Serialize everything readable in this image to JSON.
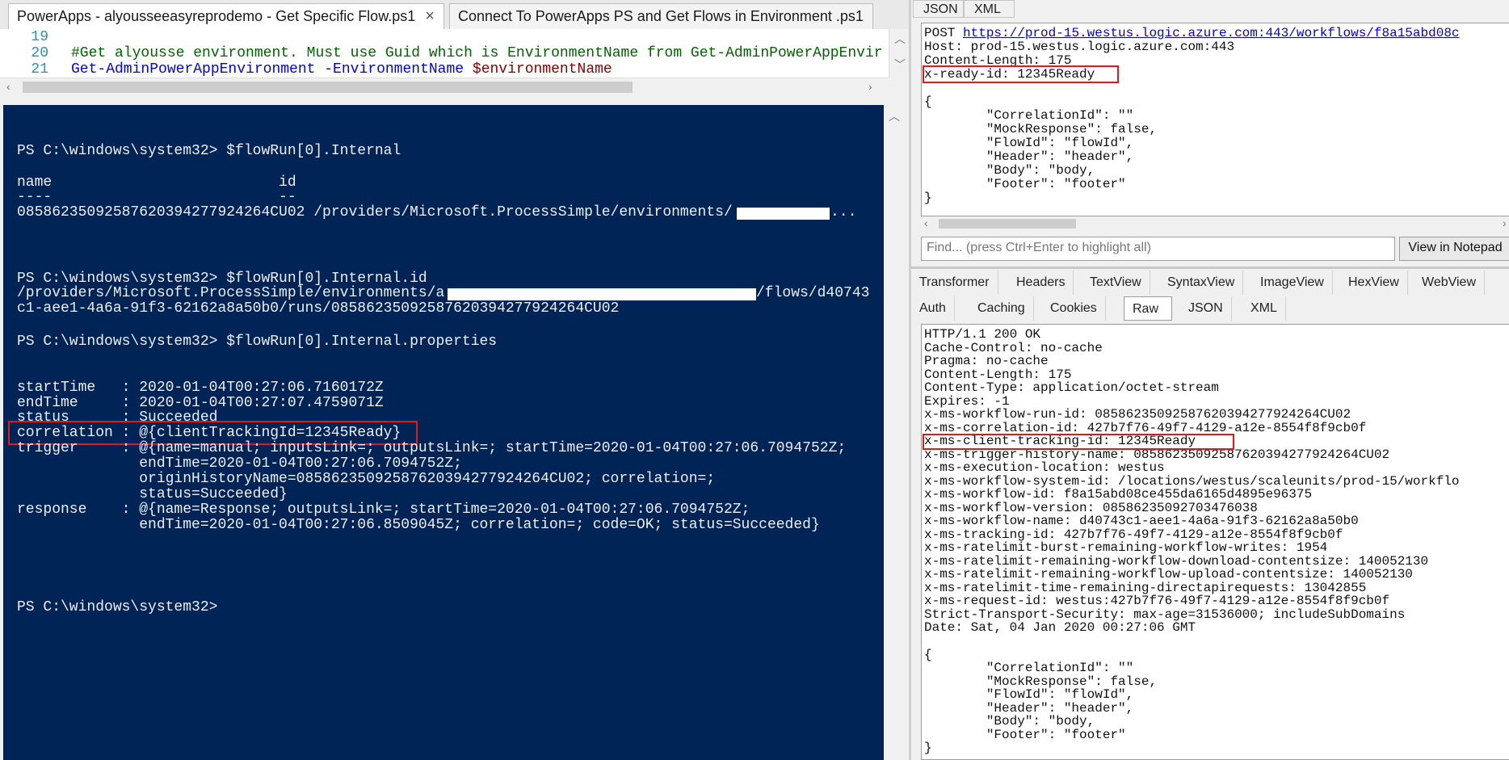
{
  "ise": {
    "tabs": [
      {
        "label": "PowerApps - alyousseeasyreprodemo - Get Specific Flow.ps1",
        "close": "×"
      },
      {
        "label": "Connect To PowerApps PS and Get Flows in Environment .ps1"
      }
    ],
    "editor": {
      "lines": [
        {
          "num": "19",
          "comment": "",
          "cmd": "",
          "arg": "",
          "var": ""
        },
        {
          "num": "20",
          "comment": "#Get alyousse environment. Must use Guid which is EnvironmentName from Get-AdminPowerAppEnvir",
          "cmd": "",
          "arg": "",
          "var": ""
        },
        {
          "num": "21",
          "comment": "",
          "cmd": "Get-AdminPowerAppEnvironment",
          "arg": " -EnvironmentName ",
          "var": "$environmentName"
        }
      ]
    },
    "console": {
      "lines": [
        "PS C:\\windows\\system32> $flowRun[0].Internal",
        "name                          id",
        "----                          --",
        "08586235092587620394277924264CU02 /providers/Microsoft.ProcessSimple/environments/",
        "...",
        "PS C:\\windows\\system32> $flowRun[0].Internal.id",
        "/providers/Microsoft.ProcessSimple/environments/a",
        "/flows/d40743",
        "c1-aee1-4a6a-91f3-62162a8a50b0/runs/08586235092587620394277924264CU02",
        "PS C:\\windows\\system32> $flowRun[0].Internal.properties",
        "startTime   : 2020-01-04T00:27:06.7160172Z",
        "endTime     : 2020-01-04T00:27:07.4759071Z",
        "status      : Succeeded",
        "correlation : @{clientTrackingId=12345Ready}",
        "trigger     : @{name=manual; inputsLink=; outputsLink=; startTime=2020-01-04T00:27:06.7094752Z;",
        "              endTime=2020-01-04T00:27:06.7094752Z;",
        "              originHistoryName=08586235092587620394277924264CU02; correlation=;",
        "              status=Succeeded}",
        "response    : @{name=Response; outputsLink=; startTime=2020-01-04T00:27:06.7094752Z;",
        "              endTime=2020-01-04T00:27:06.8509045Z; correlation=; code=OK; status=Succeeded}",
        "PS C:\\windows\\system32>"
      ]
    }
  },
  "fiddler": {
    "request_tabs": [
      "JSON",
      "XML"
    ],
    "request": {
      "method": "POST",
      "url": "https://prod-15.westus.logic.azure.com:443/workflows/f8a15abd08c",
      "lines": [
        "Host: prod-15.westus.logic.azure.com:443",
        "Content-Length: 175",
        "x-ready-id: 12345Ready",
        "{",
        "        \"CorrelationId\": \"\"",
        "        \"MockResponse\": false,",
        "        \"FlowId\": \"flowId\",",
        "        \"Header\": \"header\",",
        "        \"Body\": \"body,",
        "        \"Footer\": \"footer\"",
        "}"
      ]
    },
    "find": {
      "placeholder": "Find... (press Ctrl+Enter to highlight all)",
      "button": "View in Notepad"
    },
    "response_tabs_row1": [
      "Transformer",
      "Headers",
      "TextView",
      "SyntaxView",
      "ImageView",
      "HexView",
      "WebView"
    ],
    "response_tabs_row2": [
      "Auth",
      "Caching",
      "Cookies",
      "Raw",
      "JSON",
      "XML"
    ],
    "response_selected_tab": "Raw",
    "response": {
      "lines": [
        "HTTP/1.1 200 OK",
        "Cache-Control: no-cache",
        "Pragma: no-cache",
        "Content-Length: 175",
        "Content-Type: application/octet-stream",
        "Expires: -1",
        "x-ms-workflow-run-id: 08586235092587620394277924264CU02",
        "x-ms-correlation-id: 427b7f76-49f7-4129-a12e-8554f8f9cb0f",
        "x-ms-client-tracking-id: 12345Ready",
        "x-ms-trigger-history-name: 08586235092587620394277924264CU02",
        "x-ms-execution-location: westus",
        "x-ms-workflow-system-id: /locations/westus/scaleunits/prod-15/workflo",
        "x-ms-workflow-id: f8a15abd08ce455da6165d4895e96375",
        "x-ms-workflow-version: 08586235092703476038",
        "x-ms-workflow-name: d40743c1-aee1-4a6a-91f3-62162a8a50b0",
        "x-ms-tracking-id: 427b7f76-49f7-4129-a12e-8554f8f9cb0f",
        "x-ms-ratelimit-burst-remaining-workflow-writes: 1954",
        "x-ms-ratelimit-remaining-workflow-download-contentsize: 140052130",
        "x-ms-ratelimit-remaining-workflow-upload-contentsize: 140052130",
        "x-ms-ratelimit-time-remaining-directapirequests: 13042855",
        "x-ms-request-id: westus:427b7f76-49f7-4129-a12e-8554f8f9cb0f",
        "Strict-Transport-Security: max-age=31536000; includeSubDomains",
        "Date: Sat, 04 Jan 2020 00:27:06 GMT",
        "{",
        "        \"CorrelationId\": \"\"",
        "        \"MockResponse\": false,",
        "        \"FlowId\": \"flowId\",",
        "        \"Header\": \"header\",",
        "        \"Body\": \"body,",
        "        \"Footer\": \"footer\"",
        "}"
      ]
    }
  }
}
